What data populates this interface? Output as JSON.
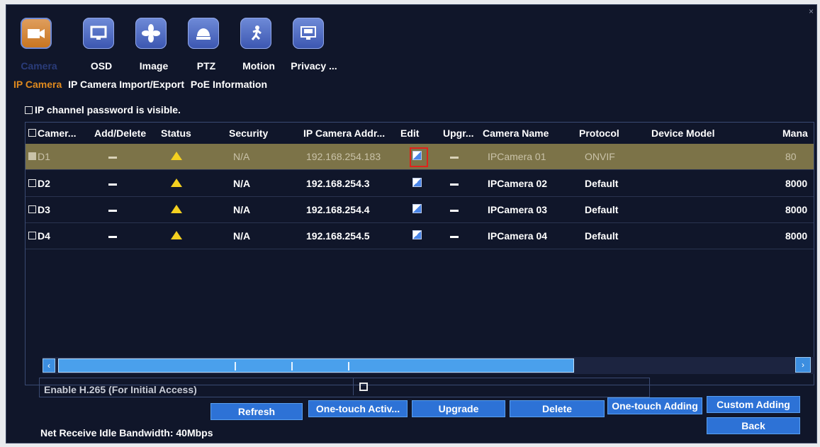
{
  "top_tabs": [
    {
      "label": "Camera",
      "icon": "camera-icon"
    },
    {
      "label": "OSD",
      "icon": "monitor-icon"
    },
    {
      "label": "Image",
      "icon": "fan-icon"
    },
    {
      "label": "PTZ",
      "icon": "dome-camera-icon"
    },
    {
      "label": "Motion",
      "icon": "running-man-icon"
    },
    {
      "label": "Privacy ...",
      "icon": "privacy-screen-icon"
    }
  ],
  "sub_tabs": [
    "IP Camera",
    "IP Camera Import/Export",
    "PoE Information"
  ],
  "password_visible_label": "IP channel password is visible.",
  "table": {
    "columns": [
      "Camer...",
      "Add/Delete",
      "Status",
      "Security",
      "IP Camera Addr...",
      "Edit",
      "Upgr...",
      "Camera Name",
      "Protocol",
      "Device Model",
      "Mana"
    ],
    "rows": [
      {
        "channel": "D1",
        "security": "N/A",
        "ip": "192.168.254.183",
        "name": "IPCamera 01",
        "protocol": "ONVIF",
        "model": "",
        "port": "80"
      },
      {
        "channel": "D2",
        "security": "N/A",
        "ip": "192.168.254.3",
        "name": "IPCamera 02",
        "protocol": "Default",
        "model": "",
        "port": "8000"
      },
      {
        "channel": "D3",
        "security": "N/A",
        "ip": "192.168.254.4",
        "name": "IPCamera 03",
        "protocol": "Default",
        "model": "",
        "port": "8000"
      },
      {
        "channel": "D4",
        "security": "N/A",
        "ip": "192.168.254.5",
        "name": "IPCamera 04",
        "protocol": "Default",
        "model": "",
        "port": "8000"
      }
    ]
  },
  "h265_label": "Enable H.265 (For Initial Access)",
  "buttons": {
    "refresh": "Refresh",
    "one_touch_activate": "One-touch Activ...",
    "upgrade": "Upgrade",
    "delete": "Delete",
    "one_touch_adding": "One-touch Adding",
    "custom_adding": "Custom Adding",
    "back": "Back"
  },
  "bandwidth": "Net Receive Idle Bandwidth: 40Mbps",
  "colors": {
    "active_tab": "#e08a1e",
    "button": "#2d72d6",
    "warning": "#f4d020",
    "selection": "#7c7348"
  }
}
